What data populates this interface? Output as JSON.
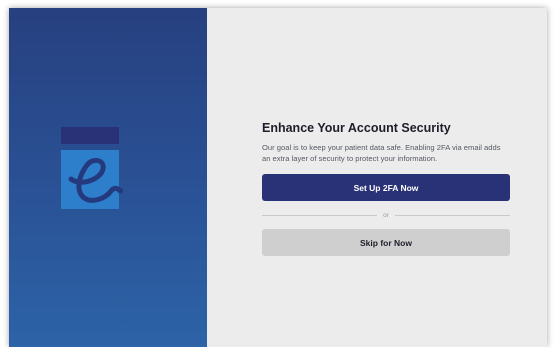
{
  "brand": {
    "logo_icon": "e-notepad-logo-icon",
    "colors": {
      "panel_top": "#27407f",
      "panel_bottom": "#2d63a8",
      "logo_header": "#2a3277",
      "logo_body": "#2d7ecb",
      "logo_glyph": "#253a7e",
      "primary_button": "#2a3277",
      "secondary_button": "#cfcfcf",
      "background": "#ececec"
    }
  },
  "security_prompt": {
    "title": "Enhance Your Account Security",
    "description": "Our goal is to keep your patient data safe. Enabling 2FA via email adds an extra layer of security to protect your information.",
    "primary_label": "Set Up 2FA Now",
    "divider_label": "or",
    "secondary_label": "Skip for Now"
  }
}
